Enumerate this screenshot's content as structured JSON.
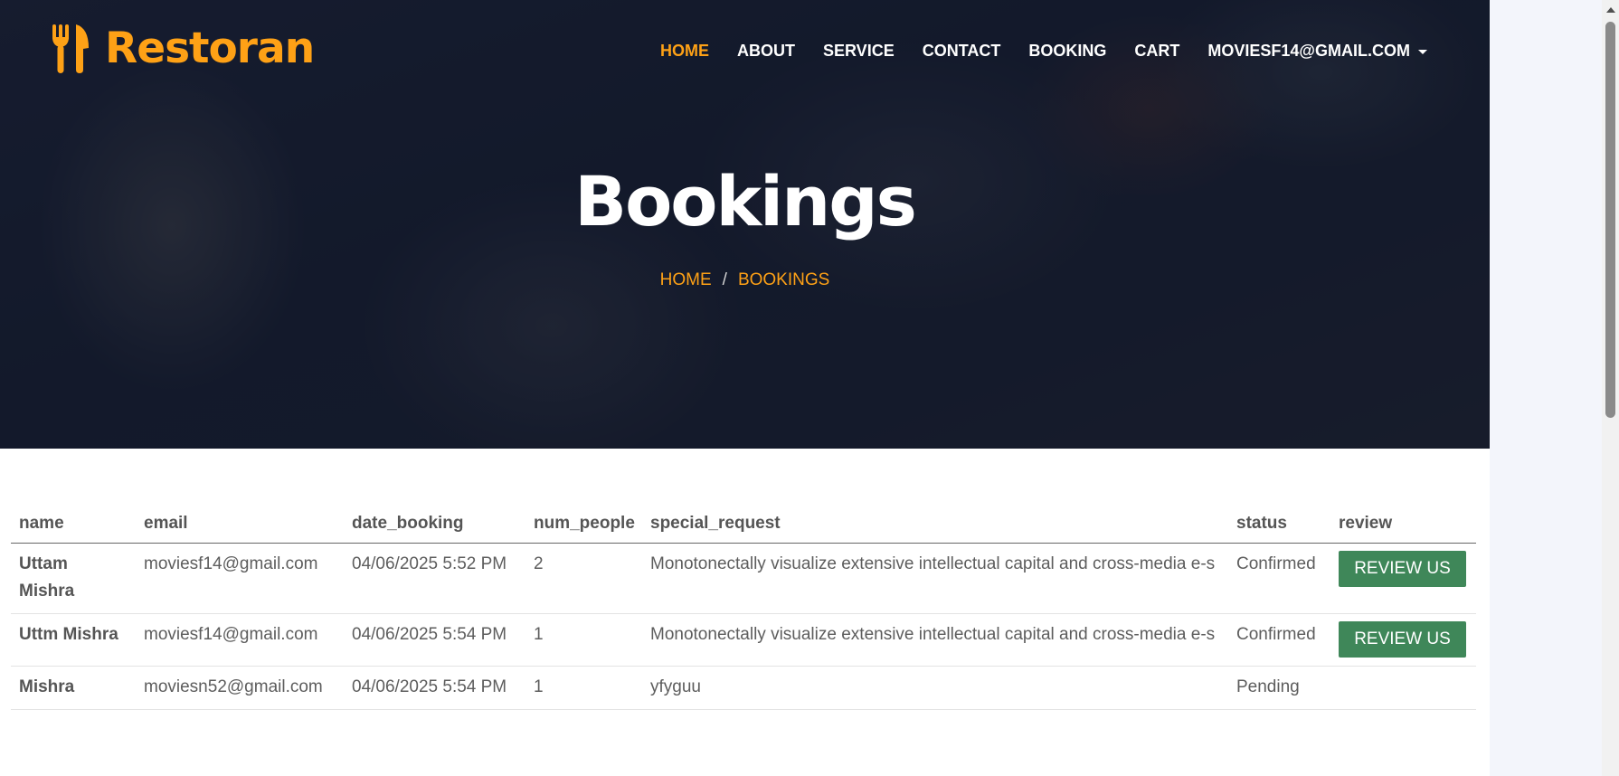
{
  "brand": {
    "name": "Restoran",
    "icon": "utensils-icon",
    "accent_color": "#FEA116"
  },
  "nav": {
    "items": [
      {
        "label": "HOME",
        "active": true
      },
      {
        "label": "ABOUT",
        "active": false
      },
      {
        "label": "SERVICE",
        "active": false
      },
      {
        "label": "CONTACT",
        "active": false
      },
      {
        "label": "BOOKING",
        "active": false
      },
      {
        "label": "CART",
        "active": false
      }
    ],
    "user_email": "MOVIESF14@GMAIL.COM"
  },
  "hero": {
    "title": "Bookings",
    "breadcrumb": [
      "HOME",
      "BOOKINGS"
    ],
    "breadcrumb_separator": "/"
  },
  "table": {
    "headers": [
      "name",
      "email",
      "date_booking",
      "num_people",
      "special_request",
      "status",
      "review"
    ],
    "rows": [
      {
        "name": "Uttam Mishra",
        "email": "moviesf14@gmail.com",
        "date_booking": "04/06/2025 5:52 PM",
        "num_people": "2",
        "special_request": "Monotonectally visualize extensive intellectual capital and cross-media e-s",
        "status": "Confirmed",
        "review": "REVIEW US"
      },
      {
        "name": "Uttm Mishra",
        "email": "moviesf14@gmail.com",
        "date_booking": "04/06/2025 5:54 PM",
        "num_people": "1",
        "special_request": "Monotonectally visualize extensive intellectual capital and cross-media e-s",
        "status": "Confirmed",
        "review": "REVIEW US"
      },
      {
        "name": "Mishra",
        "email": "moviesn52@gmail.com",
        "date_booking": "04/06/2025 5:54 PM",
        "num_people": "1",
        "special_request": "yfyguu",
        "status": "Pending",
        "review": ""
      }
    ]
  },
  "colors": {
    "review_button": "#3f8759",
    "hero_overlay": "#0F172B"
  }
}
